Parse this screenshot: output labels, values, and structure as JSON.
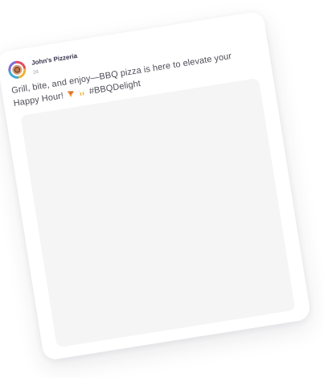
{
  "post": {
    "author_name": "John's Pizzeria",
    "time_ago": "2d",
    "caption_text": "Grill, bite, and enjoy—BBQ pizza is here to elevate your Happy Hour!",
    "hashtag": "#BBQDelight",
    "emojis": [
      "pizza-icon",
      "raised-hands-icon"
    ]
  }
}
